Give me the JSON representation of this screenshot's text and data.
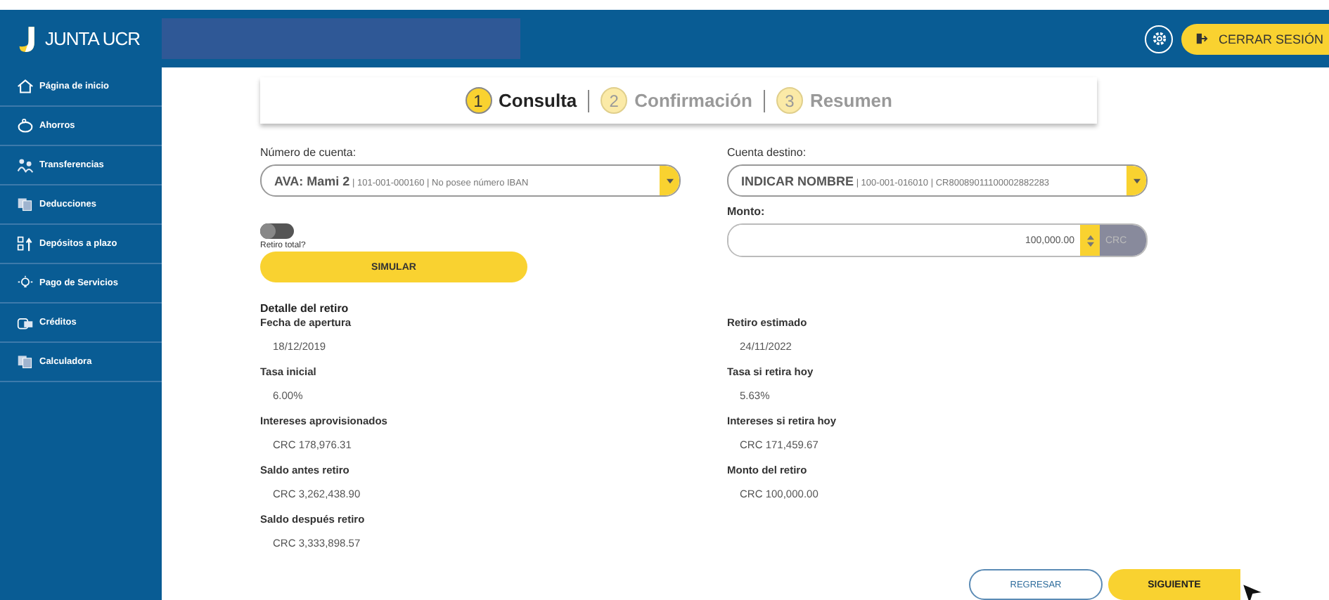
{
  "header": {
    "brand": "JUNTA UCR",
    "logout": "CERRAR SESIÓN"
  },
  "sidebar": {
    "items": [
      {
        "label": "Página de inicio",
        "kind": "home"
      },
      {
        "label": "Ahorros",
        "kind": "savings"
      },
      {
        "label": "Transferencias",
        "kind": "transfers"
      },
      {
        "label": "Deducciones",
        "kind": "deductions"
      },
      {
        "label": "Depósitos a plazo",
        "kind": "deposits"
      },
      {
        "label": "Pago de Servicios",
        "kind": "services"
      },
      {
        "label": "Créditos",
        "kind": "credits"
      },
      {
        "label": "Calculadora",
        "kind": "calculator"
      }
    ]
  },
  "steps": [
    {
      "number": "1",
      "label": "Consulta",
      "selected": true
    },
    {
      "number": "2",
      "label": "Confirmación",
      "selected": false
    },
    {
      "number": "3",
      "label": "Resumen",
      "selected": false
    }
  ],
  "account": {
    "label": "Número de cuenta:",
    "name": "AVA: Mami 2",
    "number": "| 101-001-000160 |",
    "iban": "No posee número IBAN"
  },
  "destination": {
    "label": "Cuenta destino:",
    "name": "INDICAR NOMBRE",
    "number": "| 100-001-016010 |",
    "iban": "CR80089011100002882283"
  },
  "amount": {
    "label": "Monto:",
    "value": "100,000.00",
    "currency": "CRC"
  },
  "total_withdrawal": {
    "label": "Retiro total?",
    "on": false
  },
  "simulate_button": "SIMULAR",
  "detail": {
    "title": "Detalle del retiro",
    "left": [
      {
        "label": "Fecha de apertura",
        "value": "18/12/2019"
      },
      {
        "label": "Tasa inicial",
        "value": "6.00%"
      },
      {
        "label": "Intereses aprovisionados",
        "value": "CRC 178,976.31"
      },
      {
        "label": "Saldo antes retiro",
        "value": "CRC 3,262,438.90"
      },
      {
        "label": "Saldo después retiro",
        "value": "CRC 3,333,898.57"
      }
    ],
    "right": [
      {
        "label": "Retiro estimado",
        "value": "24/11/2022"
      },
      {
        "label": "Tasa si retira hoy",
        "value": "5.63%"
      },
      {
        "label": "Intereses si retira hoy",
        "value": "CRC 171,459.67"
      },
      {
        "label": "Monto del retiro",
        "value": "CRC 100,000.00"
      }
    ]
  },
  "buttons": {
    "back": "REGRESAR",
    "next": "SIGUIENTE"
  }
}
